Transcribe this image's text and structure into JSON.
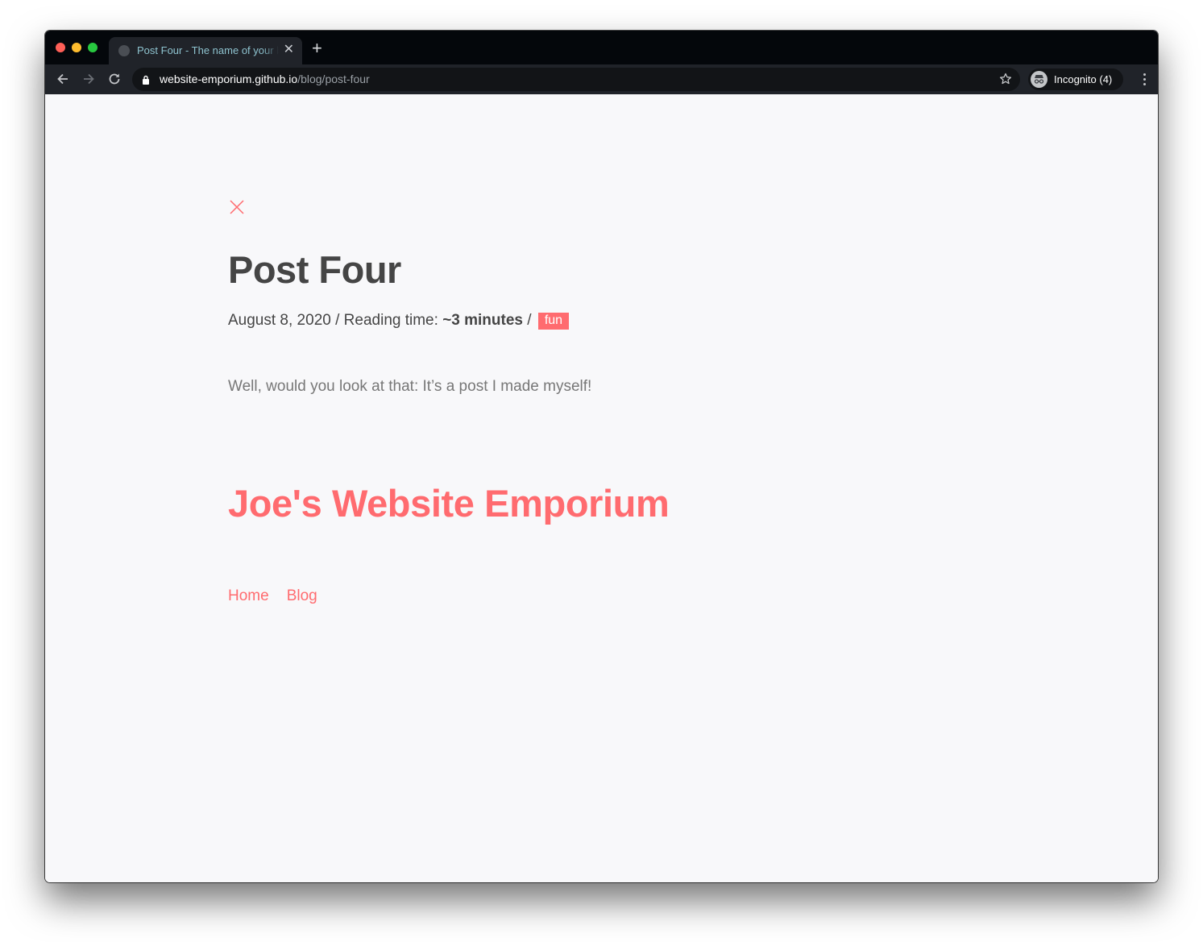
{
  "browser": {
    "tab": {
      "title": "Post Four - The name of your blog",
      "favicon": "globe-icon",
      "close_icon": "close-icon"
    },
    "new_tab_label": "+",
    "nav": {
      "back_icon": "arrow-left-icon",
      "forward_icon": "arrow-right-icon",
      "reload_icon": "reload-icon"
    },
    "address": {
      "host": "website-emporium.github.io",
      "path": "/blog/post-four",
      "lock_icon": "lock-icon",
      "bookmark_icon": "star-icon"
    },
    "profile": {
      "label": "Incognito (4)",
      "icon": "incognito-icon"
    },
    "menu_icon": "kebab-menu-icon"
  },
  "post": {
    "close_icon": "close-x-icon",
    "title": "Post Four",
    "date": "August 8, 2020",
    "separator": " / ",
    "reading_label": "Reading time: ",
    "reading_time": "~3 minutes",
    "tag": "fun",
    "body": "Well, would you look at that: It’s a post I made myself!"
  },
  "footer": {
    "site_title": "Joe's Website Emporium",
    "nav": [
      {
        "label": "Home"
      },
      {
        "label": "Blog"
      }
    ]
  },
  "colors": {
    "accent": "#ff6b6f",
    "heading": "#454545",
    "body_text": "#777777",
    "page_bg": "#f8f8fa"
  }
}
